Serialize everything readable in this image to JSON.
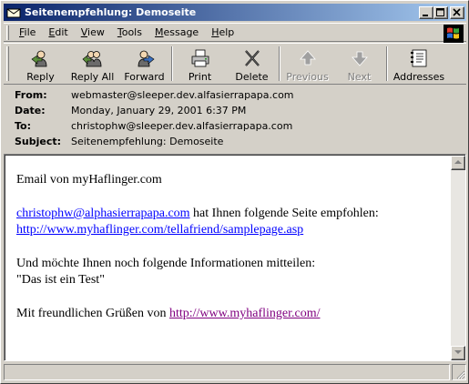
{
  "window": {
    "title": "Seitenempfehlung: Demoseite",
    "caption_buttons": [
      "minimize-icon",
      "maximize-icon",
      "close-icon"
    ]
  },
  "menubar": {
    "items": [
      {
        "label": "File",
        "underline": "F",
        "rest": "ile"
      },
      {
        "label": "Edit",
        "underline": "E",
        "rest": "dit"
      },
      {
        "label": "View",
        "underline": "V",
        "rest": "iew"
      },
      {
        "label": "Tools",
        "underline": "T",
        "rest": "ools"
      },
      {
        "label": "Message",
        "underline": "M",
        "rest": "essage"
      },
      {
        "label": "Help",
        "underline": "H",
        "rest": "elp"
      }
    ]
  },
  "toolbar": {
    "reply": "Reply",
    "reply_all": "Reply All",
    "forward": "Forward",
    "print": "Print",
    "delete": "Delete",
    "previous": "Previous",
    "next": "Next",
    "addresses": "Addresses"
  },
  "header": {
    "from_label": "From:",
    "from": "webmaster@sleeper.dev.alfasierrapapa.com",
    "date_label": "Date:",
    "date": "Monday, January 29, 2001 6:37 PM",
    "to_label": "To:",
    "to": "christophw@sleeper.dev.alfasierrapapa.com",
    "subject_label": "Subject:",
    "subject": "Seitenempfehlung: Demoseite"
  },
  "message": {
    "line1": "Email von myHaflinger.com",
    "sender_link": "christophw@alphasierrapapa.com",
    "recommend_text": " hat Ihnen folgende Seite empfohlen:",
    "page_link": "http://www.myhaflinger.com/tellafriend/samplepage.asp",
    "info_text": "Und möchte Ihnen noch folgende Informationen mitteilen:",
    "quote": "\"Das ist ein Test\"",
    "closing_text": "Mit freundlichen Grüßen von ",
    "site_link": "http://www.myhaflinger.com/"
  },
  "colors": {
    "titlebar_start": "#0a246a",
    "titlebar_end": "#a6caf0",
    "link": "#0000ff",
    "visited_link": "#800080",
    "chrome": "#d4d0c8"
  }
}
